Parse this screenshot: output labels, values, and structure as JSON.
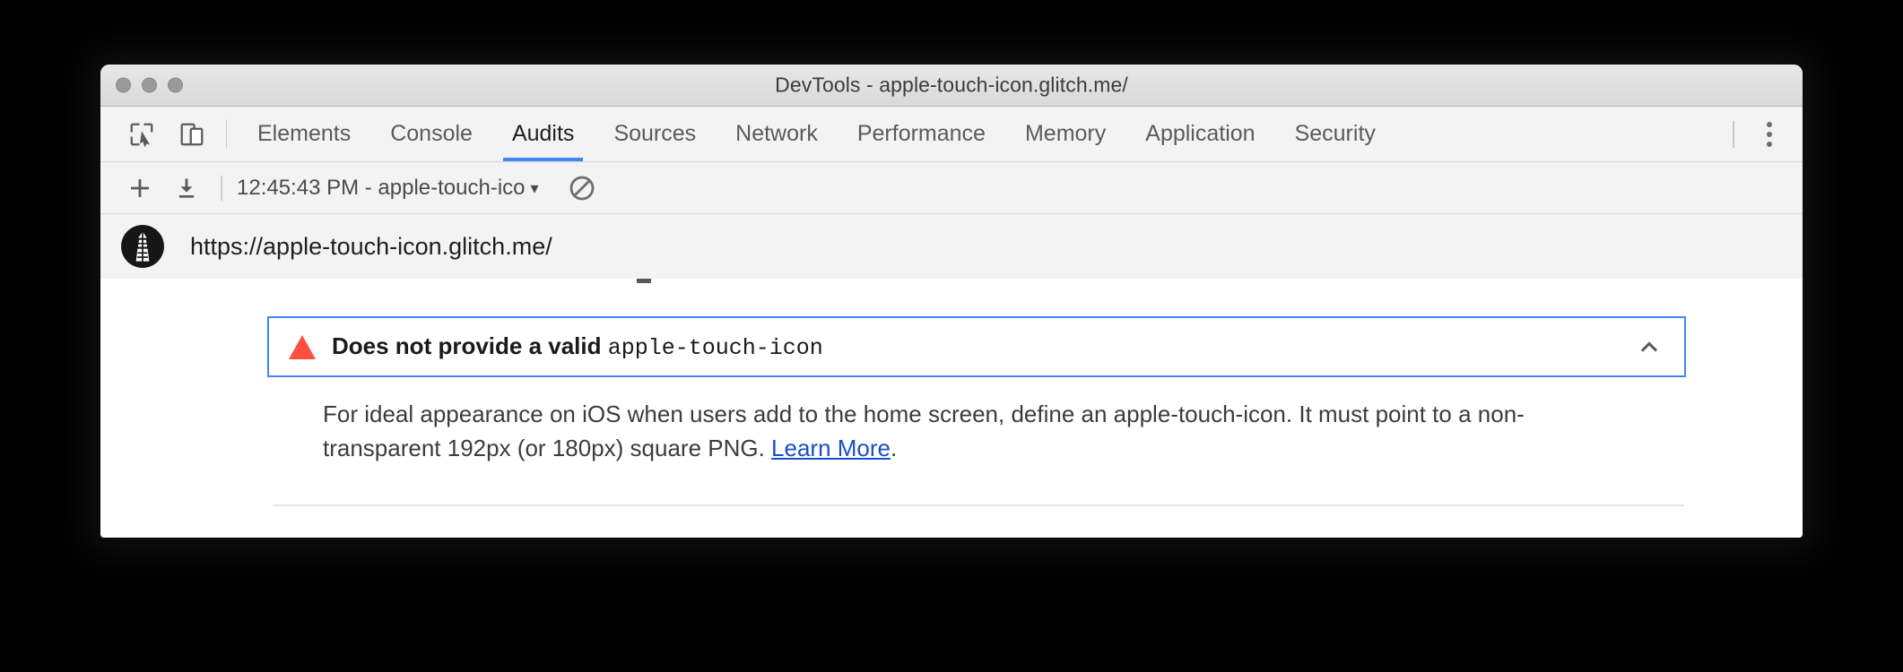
{
  "window": {
    "title": "DevTools - apple-touch-icon.glitch.me/",
    "traffic_lights": [
      "close",
      "minimize",
      "zoom"
    ],
    "chrome_color": "#d9d9d9"
  },
  "devtools": {
    "left_tools": [
      {
        "name": "inspect-element-icon",
        "label": "Inspect element"
      },
      {
        "name": "device-toolbar-icon",
        "label": "Toggle device toolbar"
      }
    ],
    "tabs": [
      {
        "label": "Elements",
        "active": false
      },
      {
        "label": "Console",
        "active": false
      },
      {
        "label": "Audits",
        "active": true
      },
      {
        "label": "Sources",
        "active": false
      },
      {
        "label": "Network",
        "active": false
      },
      {
        "label": "Performance",
        "active": false
      },
      {
        "label": "Memory",
        "active": false
      },
      {
        "label": "Application",
        "active": false
      },
      {
        "label": "Security",
        "active": false
      }
    ],
    "active_tab": "Audits",
    "accent_color": "#4285f4",
    "more_menu_label": "Customize and control DevTools"
  },
  "audit_toolbar": {
    "add_label": "+",
    "add_title": "Perform an audit",
    "download_title": "Import report",
    "report_selected": "12:45:43 PM - apple-touch-ico",
    "report_caret": "▾",
    "clear_title": "Clear all"
  },
  "report": {
    "logo_name": "lighthouse-logo",
    "url": "https://apple-touch-icon.glitch.me/"
  },
  "audit": {
    "status": "fail",
    "status_color": "#ff4e42",
    "title_text": "Does not provide a valid ",
    "title_code": "apple-touch-icon",
    "expanded": true,
    "collapse_icon": "chevron-up-icon",
    "focus_border_color": "#4285f4",
    "description_before": "For ideal appearance on iOS when users add to the home screen, define an apple-touch-icon. It must point to a non-transparent 192px (or 180px) square PNG. ",
    "link_text": "Learn More",
    "description_after": "."
  }
}
